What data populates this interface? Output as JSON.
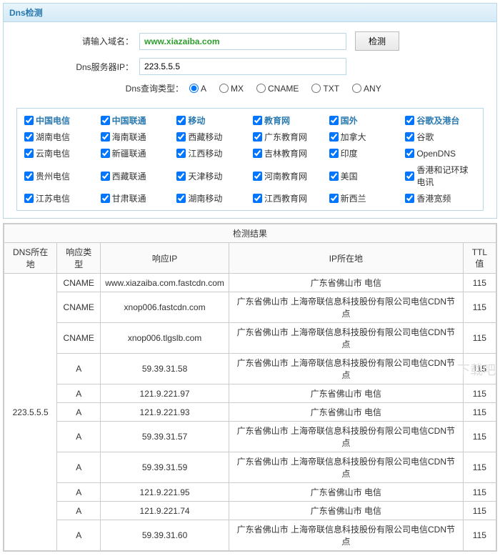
{
  "panel": {
    "title": "Dns检测"
  },
  "form": {
    "domain_label": "请输入域名：",
    "domain_value": "www.xiazaiba.com",
    "server_label": "Dns服务器IP：",
    "server_value": "223.5.5.5",
    "type_label": "Dns查询类型：",
    "submit": "检测"
  },
  "query_types": [
    "A",
    "MX",
    "CNAME",
    "TXT",
    "ANY"
  ],
  "checks": {
    "headers": [
      "中国电信",
      "中国联通",
      "移动",
      "教育网",
      "国外",
      "谷歌及港台"
    ],
    "rows": [
      [
        "湖南电信",
        "海南联通",
        "西藏移动",
        "广东教育网",
        "加拿大",
        "谷歌"
      ],
      [
        "云南电信",
        "新疆联通",
        "江西移动",
        "吉林教育网",
        "印度",
        "OpenDNS"
      ],
      [
        "贵州电信",
        "西藏联通",
        "天津移动",
        "河南教育网",
        "美国",
        "香港和记环球电讯"
      ],
      [
        "江苏电信",
        "甘肃联通",
        "湖南移动",
        "江西教育网",
        "新西兰",
        "香港宽频"
      ]
    ]
  },
  "results": {
    "title": "检测结果",
    "headers": [
      "DNS所在地",
      "响应类型",
      "响应IP",
      "IP所在地",
      "TTL值"
    ],
    "dns_loc": "223.5.5.5",
    "rows": [
      {
        "type": "CNAME",
        "ip": "www.xiazaiba.com.fastcdn.com",
        "loc": "广东省佛山市 电信",
        "ttl": "115"
      },
      {
        "type": "CNAME",
        "ip": "xnop006.fastcdn.com",
        "loc": "广东省佛山市 上海帝联信息科技股份有限公司电信CDN节点",
        "ttl": "115"
      },
      {
        "type": "CNAME",
        "ip": "xnop006.tlgslb.com",
        "loc": "广东省佛山市 上海帝联信息科技股份有限公司电信CDN节点",
        "ttl": "115"
      },
      {
        "type": "A",
        "ip": "59.39.31.58",
        "loc": "广东省佛山市 上海帝联信息科技股份有限公司电信CDN节点",
        "ttl": "115"
      },
      {
        "type": "A",
        "ip": "121.9.221.97",
        "loc": "广东省佛山市 电信",
        "ttl": "115"
      },
      {
        "type": "A",
        "ip": "121.9.221.93",
        "loc": "广东省佛山市 电信",
        "ttl": "115"
      },
      {
        "type": "A",
        "ip": "59.39.31.57",
        "loc": "广东省佛山市 上海帝联信息科技股份有限公司电信CDN节点",
        "ttl": "115"
      },
      {
        "type": "A",
        "ip": "59.39.31.59",
        "loc": "广东省佛山市 上海帝联信息科技股份有限公司电信CDN节点",
        "ttl": "115"
      },
      {
        "type": "A",
        "ip": "121.9.221.95",
        "loc": "广东省佛山市 电信",
        "ttl": "115"
      },
      {
        "type": "A",
        "ip": "121.9.221.74",
        "loc": "广东省佛山市 电信",
        "ttl": "115"
      },
      {
        "type": "A",
        "ip": "59.39.31.60",
        "loc": "广东省佛山市 上海帝联信息科技股份有限公司电信CDN节点",
        "ttl": "115"
      }
    ]
  },
  "watermark": "下载吧"
}
